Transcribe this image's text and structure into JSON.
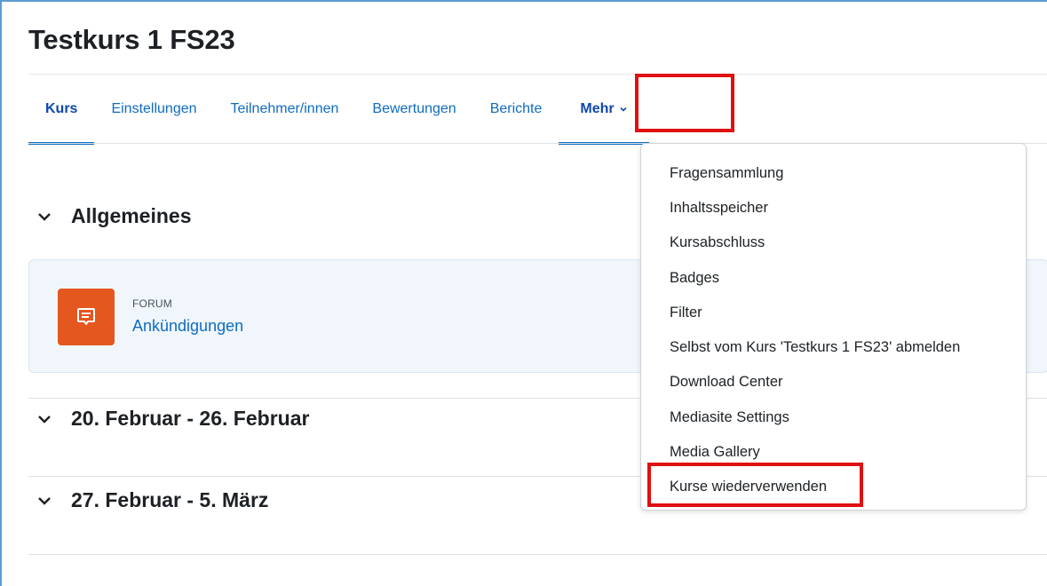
{
  "course": {
    "title": "Testkurs 1 FS23"
  },
  "tabs": [
    {
      "label": "Kurs",
      "active": true
    },
    {
      "label": "Einstellungen",
      "active": false
    },
    {
      "label": "Teilnehmer/innen",
      "active": false
    },
    {
      "label": "Bewertungen",
      "active": false
    },
    {
      "label": "Berichte",
      "active": false
    },
    {
      "label": "Mehr",
      "active": false,
      "icon": "chevron-down-icon"
    }
  ],
  "sections": [
    {
      "title": "Allgemeines",
      "icon": "chevron-down-icon"
    },
    {
      "title": "20. Februar - 26. Februar",
      "icon": "chevron-down-icon"
    },
    {
      "title": "27. Februar - 5. März",
      "icon": "chevron-down-icon"
    }
  ],
  "activity": {
    "type": "FORUM",
    "name": "Ankündigungen",
    "icon": "forum-icon"
  },
  "more_menu": {
    "items": [
      "Fragensammlung",
      "Inhaltsspeicher",
      "Kursabschluss",
      "Badges",
      "Filter",
      "Selbst vom Kurs 'Testkurs 1 FS23' abmelden",
      "Download Center",
      "Mediasite Settings",
      "Media Gallery",
      "Kurse wiederverwenden"
    ]
  },
  "colors": {
    "link": "#0f6cbf",
    "active_tab": "#0f47ad",
    "forum_icon_bg": "#e4571f",
    "highlight_box": "#e01010",
    "card_bg": "#f0f6fc"
  }
}
